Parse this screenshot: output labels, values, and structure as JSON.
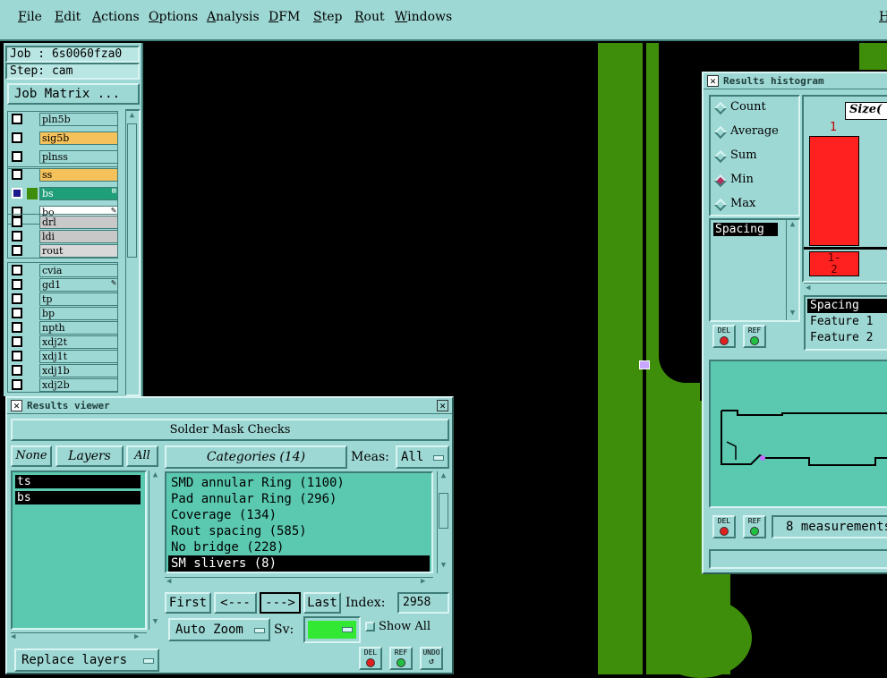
{
  "menubar": {
    "items": [
      "File",
      "Edit",
      "Actions",
      "Options",
      "Analysis",
      "DFM",
      "Step",
      "Rout",
      "Windows"
    ],
    "help": "H"
  },
  "job": {
    "job_label": "Job : 6s0060fza0",
    "step_label": "Step: cam",
    "matrix_button": "Job Matrix ..."
  },
  "layers": [
    {
      "name": "pln5b",
      "color": "#9ed8d4"
    },
    {
      "name": "sig5b",
      "color": "#f5c15a"
    },
    {
      "name": "plnss",
      "color": "#9ed8d4"
    },
    {
      "name": "ss",
      "color": "#f5c15a"
    },
    {
      "name": "bs",
      "color": "#1f9e7a"
    },
    {
      "name": "bo",
      "color": "#ffffff"
    },
    {
      "name": "drl",
      "color": "#c8c8c8"
    },
    {
      "name": "ldi",
      "color": "#c8c8c8"
    },
    {
      "name": "rout",
      "color": "#d8d8d8"
    },
    {
      "name": "cvia",
      "color": "#9ed8d4"
    },
    {
      "name": "gd1",
      "color": "#9ed8d4"
    },
    {
      "name": "tp",
      "color": "#9ed8d4"
    },
    {
      "name": "bp",
      "color": "#9ed8d4"
    },
    {
      "name": "npth",
      "color": "#9ed8d4"
    },
    {
      "name": "xdj2t",
      "color": "#9ed8d4"
    },
    {
      "name": "xdj1t",
      "color": "#9ed8d4"
    },
    {
      "name": "xdj1b",
      "color": "#9ed8d4"
    },
    {
      "name": "xdj2b",
      "color": "#9ed8d4"
    }
  ],
  "results_viewer": {
    "title": "Results viewer",
    "header": "Solder Mask Checks",
    "none_btn": "None",
    "layers_btn": "Layers",
    "all_btn": "All",
    "layer_list": [
      "ts",
      "bs"
    ],
    "categories_btn": "Categories (14)",
    "meas_label": "Meas:",
    "meas_value": "All",
    "categories": [
      "SMD annular Ring (1100)",
      "Pad annular Ring (296)",
      "Coverage (134)",
      "Rout spacing (585)",
      "No bridge (228)",
      "SM slivers (8)"
    ],
    "selected_category": 5,
    "first_btn": "First",
    "prev_btn": "<---",
    "next_btn": "--->",
    "last_btn": "Last",
    "index_label": "Index:",
    "index_value": "2958",
    "auto_zoom": "Auto Zoom",
    "sv_label": "Sv:",
    "show_all": "Show All",
    "replace_layers": "Replace layers",
    "del_btn": "DEL",
    "ref_btn": "REF",
    "undo_btn": "UNDO"
  },
  "histogram": {
    "title": "Results histogram",
    "stats": [
      "Count",
      "Average",
      "Sum",
      "Min",
      "Max"
    ],
    "selected_stat": "Min",
    "measure_list": [
      "Spacing"
    ],
    "size_header": "Size(",
    "bar_top_label": "1",
    "bar_bottom_label": "1-\n2",
    "bar_bottom_l1": "1-",
    "bar_bottom_l2": "2",
    "details": [
      "Spacing",
      "Feature 1",
      "Feature 2"
    ],
    "measurements_text": "8 measurements",
    "del_btn": "DEL",
    "ref_btn": "REF"
  },
  "colors": {
    "panel": "#9ed8d4",
    "list_bg": "#5ac9b0",
    "trace": "#3f8e0b",
    "bar": "#ff2020",
    "sv_swatch": "#33e833"
  }
}
